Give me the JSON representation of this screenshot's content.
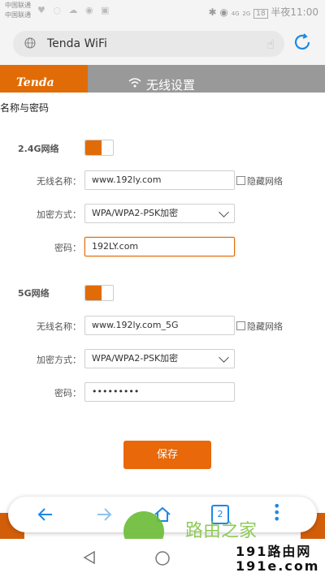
{
  "status_bar": {
    "carrier1": "中国联通",
    "carrier2": "中国联通",
    "signal": "4G",
    "signal2": "2G",
    "battery": "18",
    "time": "半夜11:00"
  },
  "browser": {
    "url_title": "Tenda WiFi",
    "tab_count": "2"
  },
  "header": {
    "logo_text": "Tenda",
    "title": "无线设置"
  },
  "panel": {
    "subtitle": "名称与密码",
    "save_label": "保存"
  },
  "network_24g": {
    "section_label": "2.4G网络",
    "toggle_on": true,
    "ssid_label": "无线名称：",
    "ssid_value": "www.192ly.com",
    "hide_label": "隐藏网络",
    "security_label": "加密方式：",
    "security_value": "WPA/WPA2-PSK加密",
    "password_label": "密码：",
    "password_value": "192LY.com"
  },
  "network_5g": {
    "section_label": "5G网络",
    "toggle_on": true,
    "ssid_label": "无线名称：",
    "ssid_value": "www.192ly.com_5G",
    "hide_label": "隐藏网络",
    "security_label": "加密方式：",
    "security_value": "WPA/WPA2-PSK加密",
    "password_label": "密码：",
    "password_value": "•••••••••"
  },
  "watermark": {
    "brand": "路由之家",
    "site1": "191路由网",
    "site2": "191e.com"
  },
  "colors": {
    "accent": "#e16c07",
    "header_gray": "#999999",
    "watermark_green": "#7cc23b"
  }
}
